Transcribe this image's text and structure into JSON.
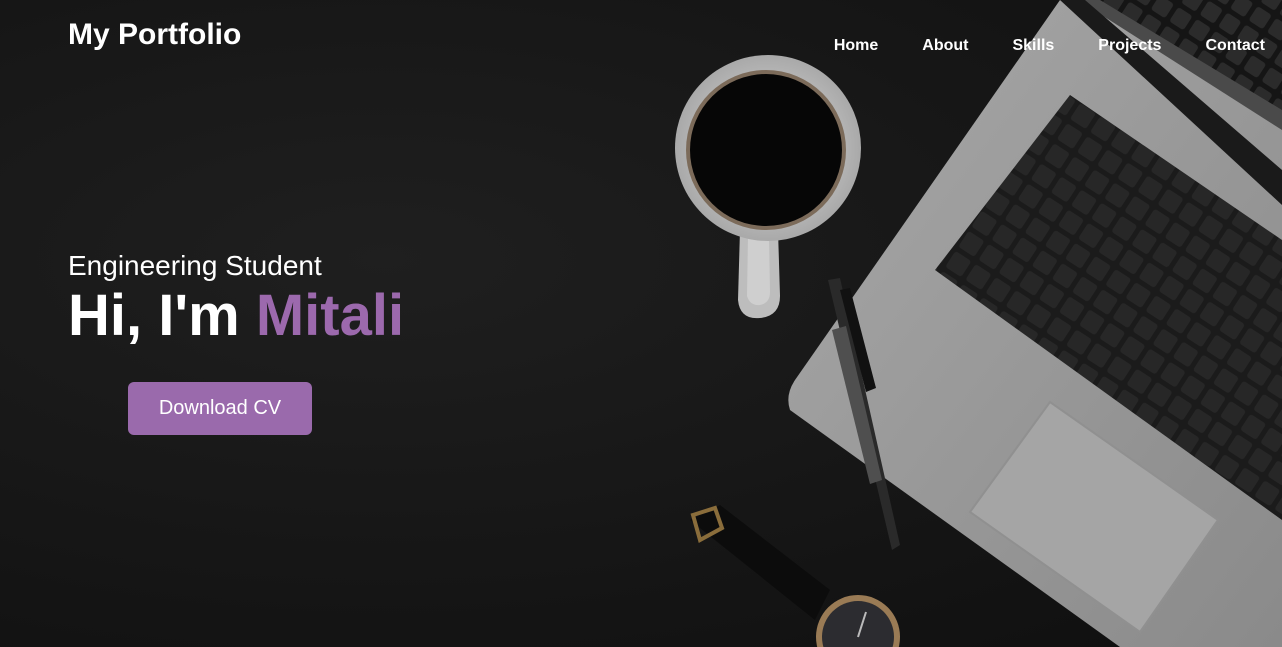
{
  "header": {
    "logo_text": "My Portfolio"
  },
  "nav": {
    "items": [
      "Home",
      "About",
      "Skills",
      "Projects",
      "Contact"
    ]
  },
  "hero": {
    "subtitle": "Engineering Student",
    "greeting": "Hi, I'm",
    "name": "Mitali",
    "cv_button_label": "Download CV",
    "background_image": "dark desk with coffee cup, laptop, pen and wristwatch"
  },
  "colors": {
    "accent": "#9c69ad",
    "button_bg": "#9a6aac",
    "background": "#151515",
    "text": "#ffffff"
  }
}
